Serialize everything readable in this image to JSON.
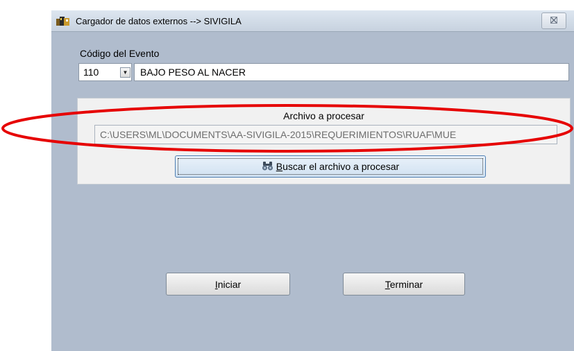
{
  "window": {
    "title": "Cargador de datos externos --> SIVIGILA",
    "close_icon": "close-icon"
  },
  "event": {
    "label": "Código del Evento",
    "code": "110",
    "name": "BAJO PESO AL NACER"
  },
  "file": {
    "group_label": "Archivo a procesar",
    "path": "C:\\USERS\\ML\\DOCUMENTS\\AA-SIVIGILA-2015\\REQUERIMIENTOS\\RUAF\\MUE",
    "browse": {
      "mnemonic": "B",
      "label_rest": "uscar el archivo a procesar",
      "icon": "binoculars-icon"
    }
  },
  "buttons": {
    "start": {
      "mnemonic": "I",
      "rest": "niciar"
    },
    "end": {
      "mnemonic": "T",
      "rest": "erminar"
    }
  },
  "colors": {
    "window_bg": "#b0bccd",
    "highlight": "#e60000"
  }
}
